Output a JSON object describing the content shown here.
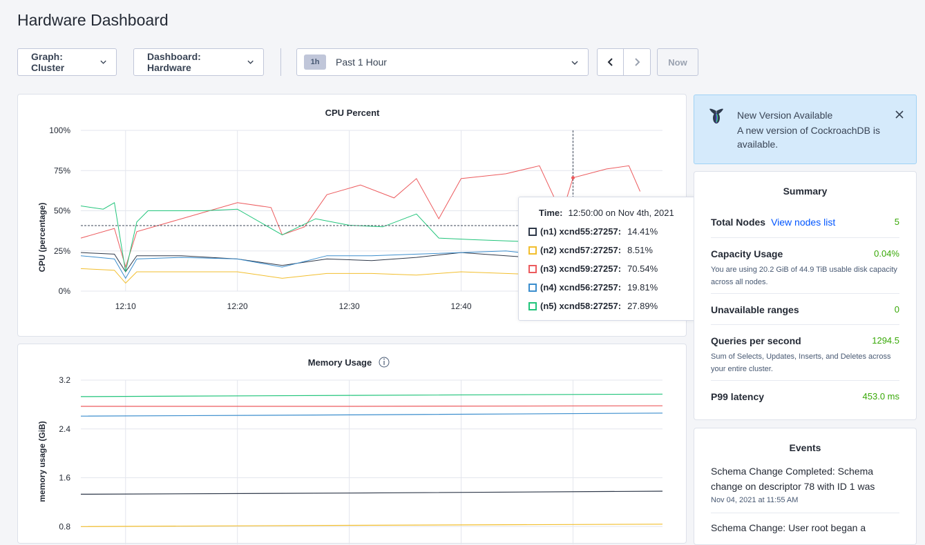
{
  "page": {
    "title": "Hardware Dashboard"
  },
  "toolbar": {
    "graph_label": "Graph: Cluster",
    "dashboard_label": "Dashboard: Hardware",
    "range_badge": "1h",
    "range_label": "Past 1 Hour",
    "now_label": "Now"
  },
  "cpu_chart": {
    "title": "CPU Percent",
    "ylabel": "CPU (percentage)",
    "y_ticks": [
      "100%",
      "75%",
      "50%",
      "25%",
      "0%"
    ],
    "x_ticks": [
      "12:10",
      "12:20",
      "12:30",
      "12:40",
      "12:5"
    ]
  },
  "memory_chart": {
    "title": "Memory Usage",
    "ylabel": "memory usage (GiB)",
    "y_ticks": [
      "3.2",
      "2.4",
      "1.6",
      "0.8"
    ]
  },
  "tooltip": {
    "time_label": "Time:",
    "time_value": "12:50:00 on Nov 4th, 2021",
    "rows": [
      {
        "name": "(n1) xcnd55:27257:",
        "value": "14.41%",
        "color": "#2d3748"
      },
      {
        "name": "(n2) xcnd57:27257:",
        "value": "8.51%",
        "color": "#f2be2c"
      },
      {
        "name": "(n3) xcnd59:27257:",
        "value": "70.54%",
        "color": "#ec5a5d"
      },
      {
        "name": "(n4) xcnd56:27257:",
        "value": "19.81%",
        "color": "#3a8dcd"
      },
      {
        "name": "(n5) xcnd58:27257:",
        "value": "27.89%",
        "color": "#20c47a"
      }
    ]
  },
  "notice": {
    "title": "New Version Available",
    "body": "A new version of CockroachDB is available."
  },
  "summary": {
    "title": "Summary",
    "total_nodes_label": "Total Nodes",
    "view_nodes_link": "View nodes list",
    "total_nodes_value": "5",
    "capacity_label": "Capacity Usage",
    "capacity_value": "0.04%",
    "capacity_desc": "You are using 20.2 GiB of 44.9 TiB usable disk capacity across all nodes.",
    "unavailable_label": "Unavailable ranges",
    "unavailable_value": "0",
    "qps_label": "Queries per second",
    "qps_value": "1294.5",
    "qps_desc": "Sum of Selects, Updates, Inserts, and Deletes across your entire cluster.",
    "p99_label": "P99 latency",
    "p99_value": "453.0 ms"
  },
  "events": {
    "title": "Events",
    "items": [
      {
        "text": "Schema Change Completed: Schema change on descriptor 78 with ID 1 was",
        "date": "Nov 04, 2021 at 11:55 AM"
      },
      {
        "text": "Schema Change: User root began a"
      }
    ]
  },
  "chart_data": [
    {
      "type": "line",
      "title": "CPU Percent",
      "ylabel": "CPU (percentage)",
      "ylim": [
        0,
        100
      ],
      "xlim": [
        "12:06",
        "12:58"
      ],
      "x_ticks": [
        "12:10",
        "12:20",
        "12:30",
        "12:40",
        "12:50"
      ],
      "grid": true,
      "hover_time": "12:50",
      "series": [
        {
          "name": "(n1) xcnd55:27257",
          "color": "#2d3748",
          "x": [
            "12:06",
            "12:09",
            "12:10",
            "12:11",
            "12:15",
            "12:20",
            "12:24",
            "12:28",
            "12:32",
            "12:36",
            "12:40",
            "12:44",
            "12:48",
            "12:49",
            "12:50",
            "12:52",
            "12:55"
          ],
          "values": [
            24,
            23,
            12,
            22,
            22,
            20,
            16,
            20,
            19,
            21,
            24,
            22,
            20,
            12,
            14,
            22,
            24
          ]
        },
        {
          "name": "(n2) xcnd57:27257",
          "color": "#f2be2c",
          "x": [
            "12:06",
            "12:09",
            "12:10",
            "12:11",
            "12:15",
            "12:20",
            "12:24",
            "12:28",
            "12:32",
            "12:36",
            "12:40",
            "12:44",
            "12:48",
            "12:49",
            "12:50",
            "12:52",
            "12:55"
          ],
          "values": [
            14,
            13,
            5,
            12,
            12,
            12,
            8,
            11,
            11,
            10,
            12,
            11,
            10,
            6,
            8.5,
            11,
            12
          ]
        },
        {
          "name": "(n3) xcnd59:27257",
          "color": "#ec5a5d",
          "x": [
            "12:06",
            "12:09",
            "12:10",
            "12:11",
            "12:15",
            "12:20",
            "12:23",
            "12:24",
            "12:26",
            "12:28",
            "12:31",
            "12:34",
            "12:36",
            "12:38",
            "12:40",
            "12:44",
            "12:47",
            "12:49",
            "12:50",
            "12:53",
            "12:55",
            "12:56"
          ],
          "values": [
            33,
            39,
            15,
            37,
            45,
            55,
            52,
            35,
            40,
            60,
            66,
            58,
            70,
            45,
            70,
            73,
            78,
            48,
            70.5,
            76,
            78,
            62
          ]
        },
        {
          "name": "(n4) xcnd56:27257",
          "color": "#3a8dcd",
          "x": [
            "12:06",
            "12:09",
            "12:10",
            "12:11",
            "12:15",
            "12:20",
            "12:24",
            "12:28",
            "12:32",
            "12:36",
            "12:40",
            "12:44",
            "12:48",
            "12:49",
            "12:50",
            "12:52",
            "12:55"
          ],
          "values": [
            22,
            20,
            8,
            20,
            21,
            20,
            15,
            22,
            22,
            23,
            24,
            25,
            22,
            14,
            19.8,
            24,
            26
          ]
        },
        {
          "name": "(n5) xcnd58:27257",
          "color": "#20c47a",
          "x": [
            "12:06",
            "12:08",
            "12:09",
            "12:10",
            "12:11",
            "12:12",
            "12:15",
            "12:17",
            "12:20",
            "12:24",
            "12:27",
            "12:30",
            "12:33",
            "12:36",
            "12:38",
            "12:41",
            "12:45",
            "12:48",
            "12:49",
            "12:50",
            "12:52",
            "12:55"
          ],
          "values": [
            53,
            51,
            55,
            12,
            43,
            50,
            50,
            50,
            51,
            35,
            45,
            41,
            40,
            48,
            33,
            32,
            31,
            30,
            17,
            27.9,
            33,
            36
          ]
        }
      ]
    },
    {
      "type": "line",
      "title": "Memory Usage",
      "ylabel": "memory usage (GiB)",
      "ylim": [
        0.6,
        3.2
      ],
      "xlim": [
        "12:06",
        "12:58"
      ],
      "grid": true,
      "series": [
        {
          "name": "(n5) xcnd58:27257",
          "color": "#20c47a",
          "x": [
            "12:06",
            "12:30",
            "12:58"
          ],
          "values": [
            2.93,
            2.95,
            2.97
          ]
        },
        {
          "name": "(n3) xcnd59:27257",
          "color": "#ec5a5d",
          "x": [
            "12:06",
            "12:30",
            "12:58"
          ],
          "values": [
            2.77,
            2.77,
            2.78
          ]
        },
        {
          "name": "(n4) xcnd56:27257",
          "color": "#3a8dcd",
          "x": [
            "12:06",
            "12:30",
            "12:58"
          ],
          "values": [
            2.61,
            2.63,
            2.66
          ]
        },
        {
          "name": "(n1) xcnd55:27257",
          "color": "#2d3748",
          "x": [
            "12:06",
            "12:30",
            "12:58"
          ],
          "values": [
            1.33,
            1.35,
            1.38
          ]
        },
        {
          "name": "(n2) xcnd57:27257",
          "color": "#f2be2c",
          "x": [
            "12:06",
            "12:30",
            "12:58"
          ],
          "values": [
            0.8,
            0.82,
            0.84
          ]
        }
      ]
    }
  ]
}
